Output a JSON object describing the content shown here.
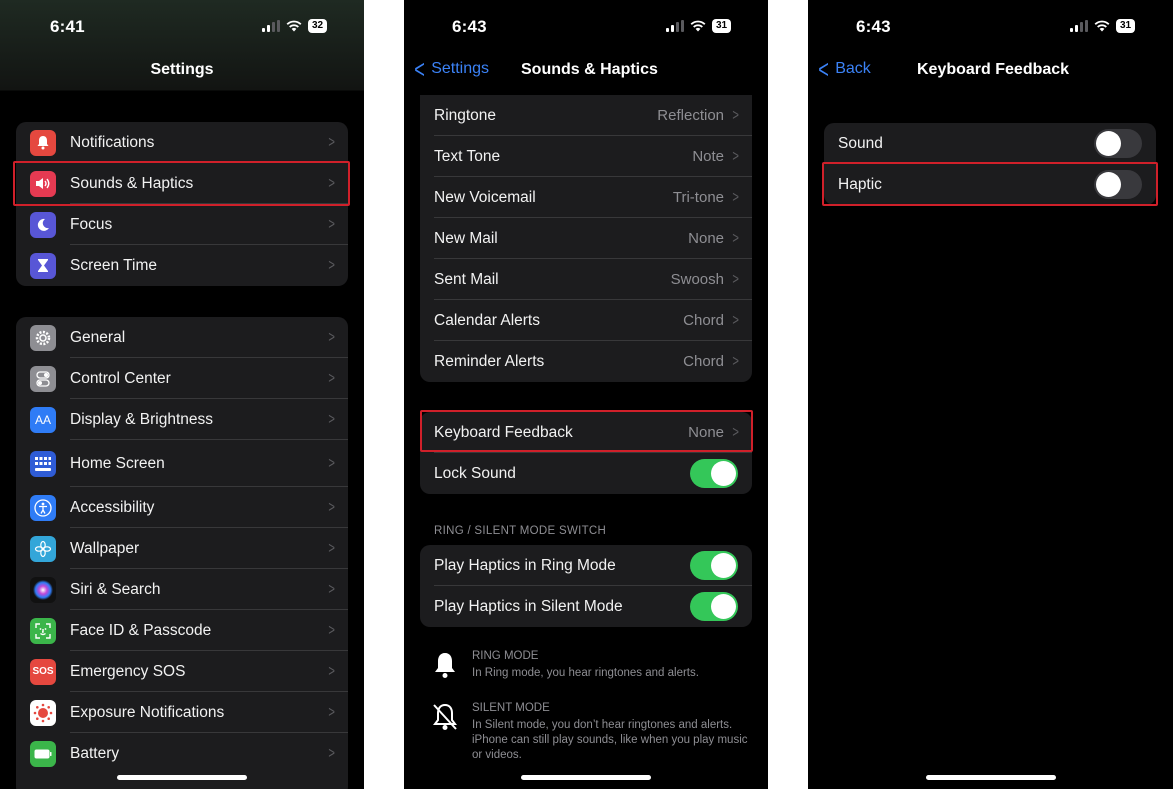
{
  "screen1": {
    "time": "6:41",
    "battery": "32",
    "title": "Settings",
    "group1": [
      {
        "label": "Notifications",
        "icon": "bell-icon",
        "color": "#e5483f"
      },
      {
        "label": "Sounds & Haptics",
        "icon": "speaker-icon",
        "color": "#e53a52"
      },
      {
        "label": "Focus",
        "icon": "moon-icon",
        "color": "#5856d6"
      },
      {
        "label": "Screen Time",
        "icon": "hourglass-icon",
        "color": "#5856d6"
      }
    ],
    "group2": [
      {
        "label": "General",
        "icon": "gear-icon",
        "color": "#8e8e93"
      },
      {
        "label": "Control Center",
        "icon": "switches-icon",
        "color": "#8e8e93"
      },
      {
        "label": "Display & Brightness",
        "icon": "text-size-icon",
        "color": "#2f7cf6",
        "glyph": "AA"
      },
      {
        "label": "Home Screen",
        "icon": "grid-icon",
        "color": "#2f5cd6"
      },
      {
        "label": "Accessibility",
        "icon": "accessibility-icon",
        "color": "#2f7cf6"
      },
      {
        "label": "Wallpaper",
        "icon": "flower-icon",
        "color": "#33a6d9"
      },
      {
        "label": "Siri & Search",
        "icon": "siri-icon",
        "color": "#2a2a2e"
      },
      {
        "label": "Face ID & Passcode",
        "icon": "face-id-icon",
        "color": "#3bb54a"
      },
      {
        "label": "Emergency SOS",
        "icon": "sos-icon",
        "color": "#e5483f",
        "glyph": "SOS"
      },
      {
        "label": "Exposure Notifications",
        "icon": "exposure-icon",
        "color": "#ffffff"
      },
      {
        "label": "Battery",
        "icon": "battery-icon",
        "color": "#3bb54a"
      }
    ]
  },
  "screen2": {
    "time": "6:43",
    "battery": "31",
    "back_label": "Settings",
    "title": "Sounds & Haptics",
    "group1": [
      {
        "label": "Ringtone",
        "value": "Reflection"
      },
      {
        "label": "Text Tone",
        "value": "Note"
      },
      {
        "label": "New Voicemail",
        "value": "Tri-tone"
      },
      {
        "label": "New Mail",
        "value": "None"
      },
      {
        "label": "Sent Mail",
        "value": "Swoosh"
      },
      {
        "label": "Calendar Alerts",
        "value": "Chord"
      },
      {
        "label": "Reminder Alerts",
        "value": "Chord"
      }
    ],
    "keyboard_feedback": {
      "label": "Keyboard Feedback",
      "value": "None"
    },
    "lock_sound": {
      "label": "Lock Sound",
      "on": true
    },
    "section_header": "RING / SILENT MODE SWITCH",
    "ring_haptics": {
      "label": "Play Haptics in Ring Mode",
      "on": true
    },
    "silent_haptics": {
      "label": "Play Haptics in Silent Mode",
      "on": true
    },
    "ring_mode": {
      "title": "RING MODE",
      "text": "In Ring mode, you hear ringtones and alerts."
    },
    "silent_mode": {
      "title": "SILENT MODE",
      "text": "In Silent mode, you don’t hear ringtones and alerts. iPhone can still play sounds, like when you play music or videos."
    }
  },
  "screen3": {
    "time": "6:43",
    "battery": "31",
    "back_label": "Back",
    "title": "Keyboard Feedback",
    "sound": {
      "label": "Sound",
      "on": false
    },
    "haptic": {
      "label": "Haptic",
      "on": false
    }
  },
  "colors": {
    "toggle_on": "#34c759",
    "accent": "#3b82f6",
    "highlight": "#d0202a"
  }
}
